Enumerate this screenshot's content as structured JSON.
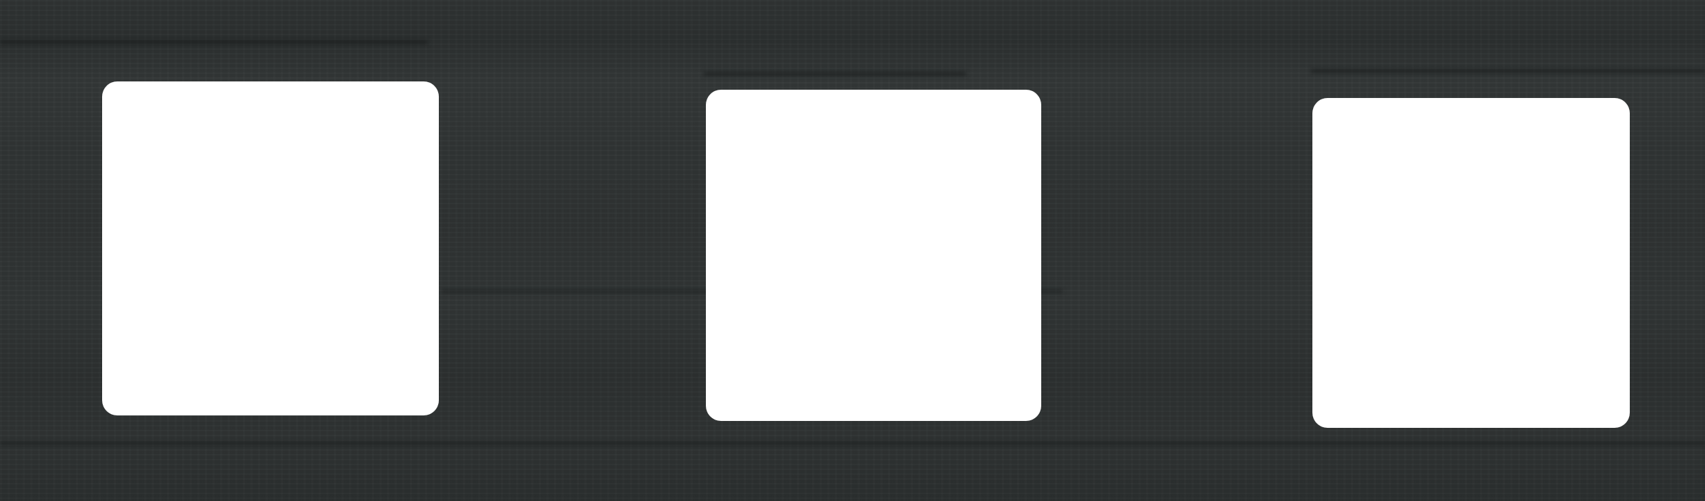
{
  "scene": {
    "background_color": "#2f3333",
    "window_color": "#ffffff",
    "windows": [
      {
        "id": "w1"
      },
      {
        "id": "w2"
      },
      {
        "id": "w3"
      }
    ]
  }
}
